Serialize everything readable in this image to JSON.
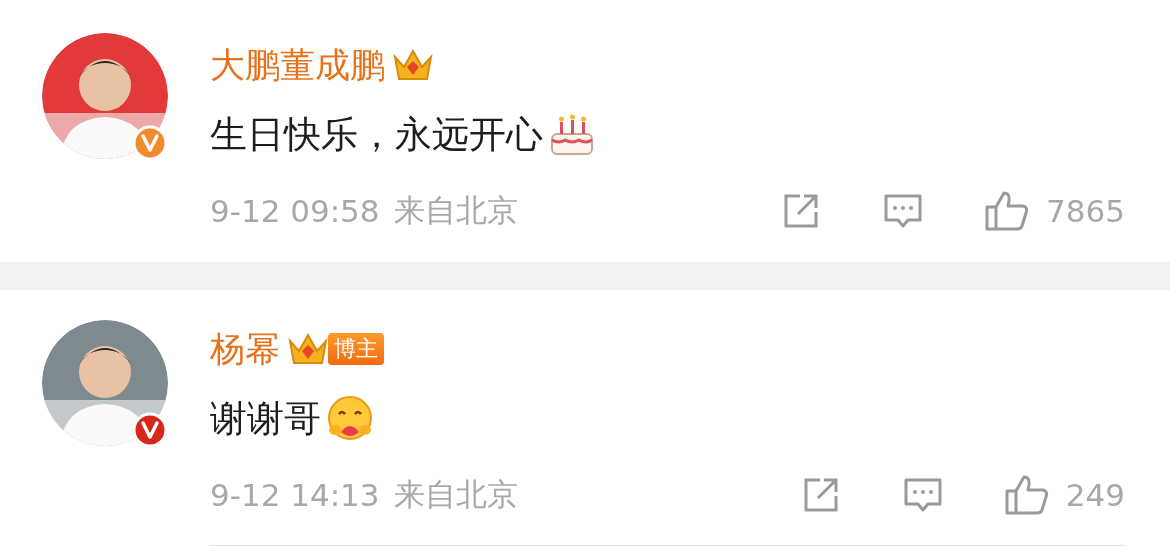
{
  "comments": [
    {
      "name": "大鹏董成鹏",
      "badge": {
        "kind": "crown"
      },
      "text": "生日快乐，永远开心",
      "emoji": {
        "kind": "cake"
      },
      "verified": {
        "color": "#f08a2c"
      },
      "date": "9-12 09:58",
      "location": "来自北京",
      "likes": "7865"
    },
    {
      "name": "杨幂",
      "badge": {
        "kind": "crown-label",
        "label": "博主"
      },
      "text": "谢谢哥",
      "emoji": {
        "kind": "hug"
      },
      "verified": {
        "color": "#d8261c"
      },
      "date": "9-12 14:13",
      "location": "来自北京",
      "likes": "249"
    }
  ]
}
